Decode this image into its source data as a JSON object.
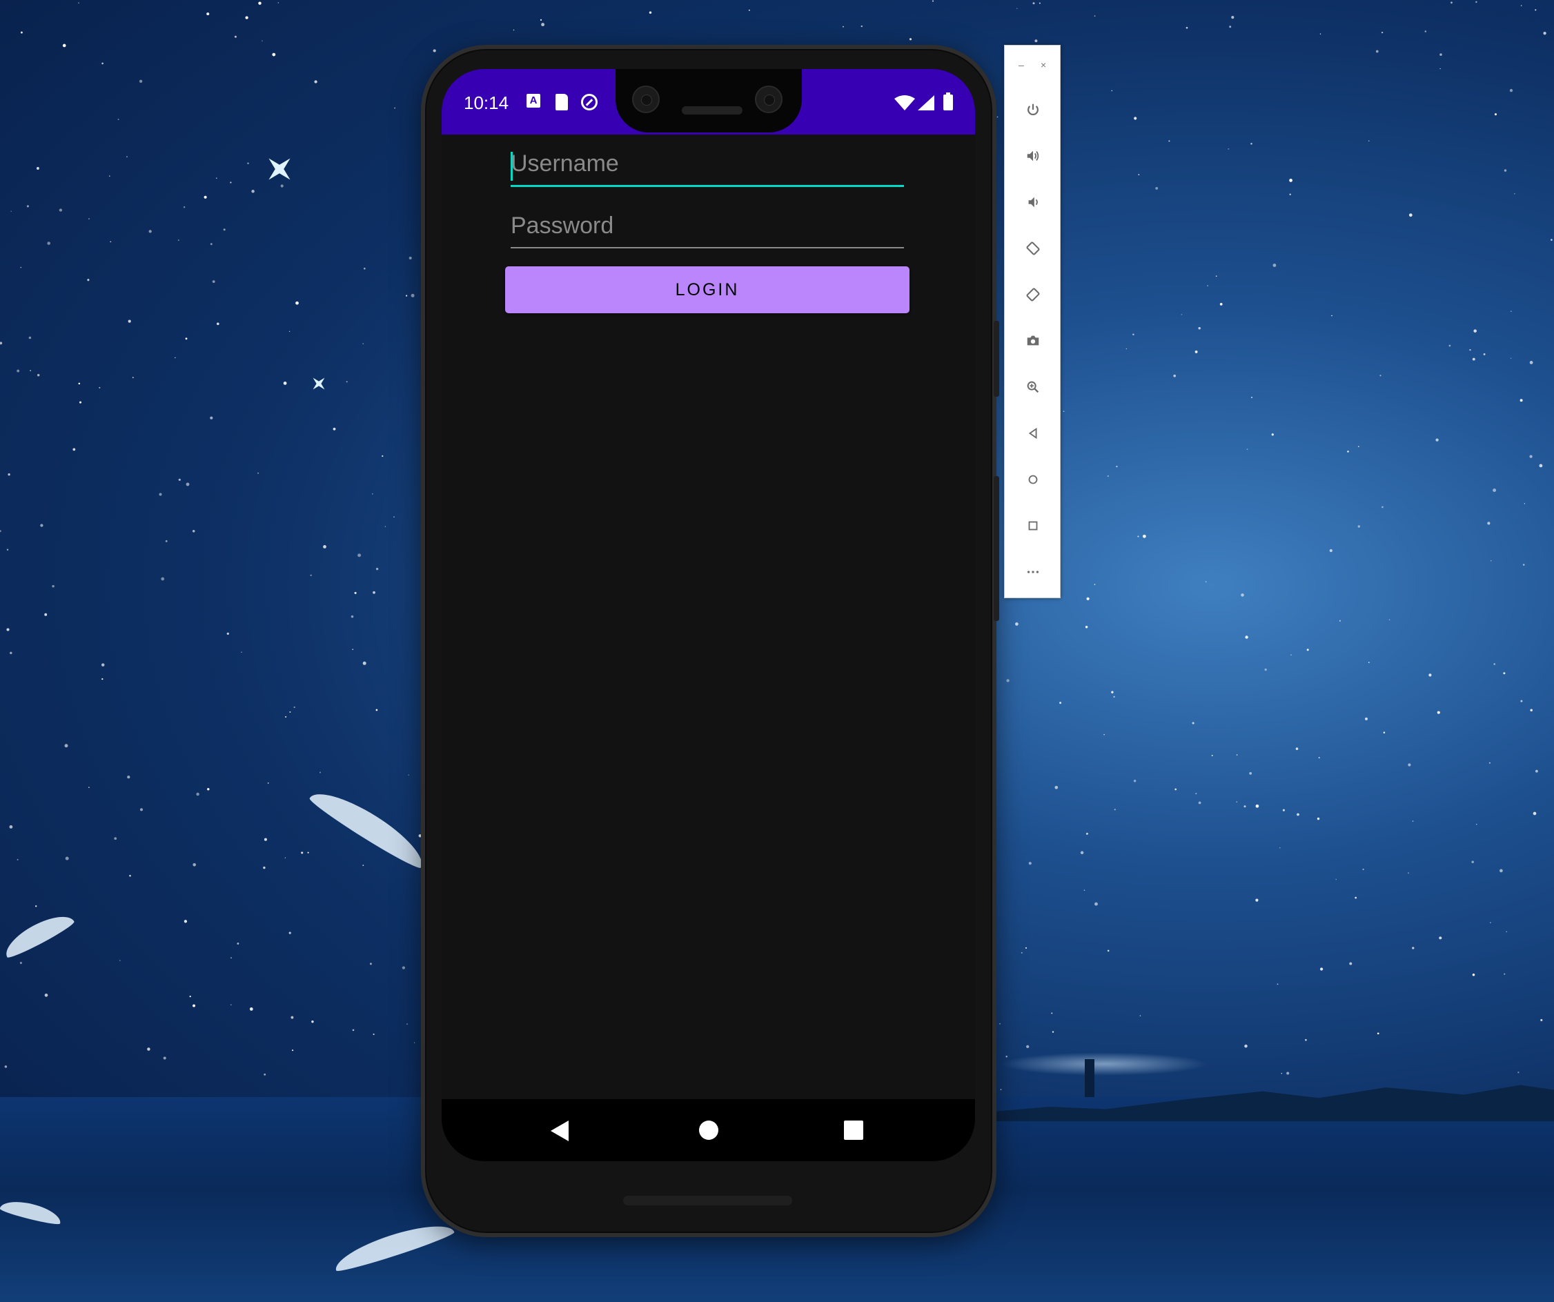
{
  "status_bar": {
    "time": "10:14",
    "icons": [
      "accessibility-a-icon",
      "sd-card-icon",
      "data-saver-icon",
      "wifi-icon",
      "cell-signal-icon",
      "battery-icon"
    ],
    "background": "#3700b3"
  },
  "login_form": {
    "username_placeholder": "Username",
    "password_placeholder": "Password",
    "login_label": "LOGIN",
    "accent_color": "#03dac5",
    "button_color": "#bb86fc"
  },
  "nav_bar": {
    "buttons": [
      "back-icon",
      "home-icon",
      "recents-icon"
    ]
  },
  "emulator_toolbar": {
    "window_controls": [
      "minimize",
      "close"
    ],
    "buttons": [
      "power",
      "volume-up",
      "volume-down",
      "rotate-left",
      "rotate-right",
      "screenshot",
      "zoom",
      "back",
      "home",
      "overview",
      "more"
    ]
  }
}
